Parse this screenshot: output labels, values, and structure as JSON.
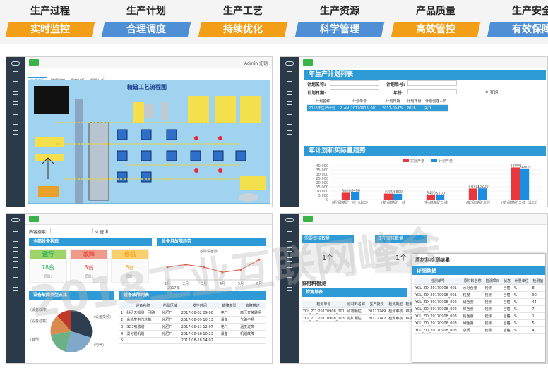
{
  "header": {
    "columns": [
      {
        "title": "生产过程",
        "badge": "实时监控",
        "color": "#f29e16"
      },
      {
        "title": "生产计划",
        "badge": "合理调度",
        "color": "#4f8fd6"
      },
      {
        "title": "生产工艺",
        "badge": "持续优化",
        "color": "#f29e16"
      },
      {
        "title": "生产资源",
        "badge": "科学管理",
        "color": "#4f8fd6"
      },
      {
        "title": "产品质量",
        "badge": "高效管控",
        "color": "#f29e16"
      },
      {
        "title": "生产安全",
        "badge": "有效保障",
        "color": "#4f8fd6"
      }
    ]
  },
  "panel_process": {
    "tabs": [
      "工艺流程",
      "数据监控",
      "报表分析",
      "报警分析"
    ],
    "diagram_title": "精硫工艺流程图",
    "user_label": "Admin 注销"
  },
  "panel_plan": {
    "title": "年生产计划列表",
    "plan_name_label": "计划名称:",
    "plan_no_label": "计划单号:",
    "plan_date_label": "计划日期:",
    "year_label": "年份:",
    "query_button": "查询",
    "table": {
      "headers": [
        "计划名称",
        "计划单号",
        "计划日期",
        "计划年份",
        "计划创建人员"
      ],
      "row": [
        "2016年生产计划",
        "PLAN_20170915_001",
        "2017-09-05",
        "2016",
        "关飞"
      ]
    },
    "chart_title": "年计划和实际量趋势"
  },
  "chart_data": {
    "type": "bar",
    "categories": [
      "(新)硫精矿一线（出口）",
      "(新)硫精矿一线",
      "(新)硫精矿二线",
      "(新)硫精矿三线",
      "(新)硫精矿二线（出口）"
    ],
    "series": [
      {
        "name": "实际产量",
        "values": [
          8000,
          7000,
          5400,
          13000,
          38000
        ],
        "color": "#e8383d"
      },
      {
        "name": "计划产量",
        "values": [
          8400,
          6800,
          5200,
          13200,
          36000
        ],
        "color": "#1c8de0"
      }
    ],
    "ylim": [
      0,
      40000
    ],
    "yticks": [
      0,
      5000,
      10000,
      15000,
      20000,
      25000,
      30000,
      35000,
      40000
    ],
    "ytick_labels": [
      "0",
      "5,000",
      "10,000",
      "15,000",
      "20,000",
      "25,000",
      "30,000",
      "35,000",
      "40,000"
    ],
    "data_labels": [
      "8000",
      "8400",
      "7000",
      "6800",
      "5400",
      "5200",
      "13000",
      "13200",
      "38000",
      "36000"
    ]
  },
  "panel_equipment": {
    "search_label": "内容搜索:",
    "query_button": "查询",
    "status_title": "全部设备状态",
    "status": [
      {
        "label": "运行",
        "count": "78台",
        "color": "#27ae60",
        "bar": "#9ed36a"
      },
      {
        "label": "故障",
        "count": "3台",
        "color": "#e74c3c",
        "bar": "#f09a8c"
      },
      {
        "label": "停机",
        "count": "8台",
        "color": "#f5a623",
        "bar": "#f7cf6c"
      }
    ],
    "ratio_label": "同比",
    "trend_title": "设备月故障趋势",
    "trend_legend": "故障设备数",
    "trend_months": [
      "2017年",
      "1月",
      "2月",
      "3月",
      "4月",
      "5月",
      "6月"
    ],
    "trend_points": [
      5,
      6,
      5,
      3,
      4,
      8
    ],
    "pie_title": "设备故障类型占比",
    "pie_legend": [
      "(设备故障)",
      "(设备过载)",
      "(设备变频)",
      "(其他)",
      "(电气)"
    ],
    "list_title": "设备故障列表",
    "list_headers": [
      "",
      "设备名称",
      "所属区域",
      "发生时间",
      "故障类型",
      "故障描述"
    ],
    "list_rows": [
      [
        "1",
        "科研无损测一回路",
        "化肥厂",
        "2017-08-02 09:00",
        "电气",
        "高压开关跳闸"
      ],
      [
        "2",
        "余热发电汽轮机",
        "化肥厂",
        "2017-08-09 10:13",
        "设备",
        "气路不畅"
      ],
      [
        "3",
        "SO3吸收塔",
        "化肥厂",
        "2017-08-11 12:07",
        "电气",
        "温度过高"
      ],
      [
        "4",
        "溴化锂机组",
        "化肥厂",
        "2017-08-16 10:23",
        "设备",
        "机组故障"
      ],
      [
        "5",
        "",
        "",
        "2017-08-18 14:02",
        "",
        ""
      ]
    ]
  },
  "panel_quality": {
    "card1_label": "需要审核数量",
    "card1_value": "1个",
    "card2_label": "正在审核数量",
    "card2_value": "1个",
    "material_title": "原材料检测",
    "detect_title": "检测总表",
    "detect_headers": [
      "检测单号",
      "原材料名称",
      "生产批次",
      "检测类型",
      "检测状态"
    ],
    "detect_rows": [
      [
        "YCL_ZD_20170908_001",
        "矿物颗粒",
        "20171249",
        "检测审核",
        "审核"
      ],
      [
        "YCL_ZD_20170908_003",
        "铁矿颗粒",
        "20172142",
        "检测审核",
        "审核"
      ]
    ],
    "result_title": "原材料检测结果",
    "detail_title": "详细数据",
    "detail_headers": [
      "检测单号",
      "原材料名称",
      "检测项目",
      "状态",
      "计量单位",
      "检测值"
    ],
    "detail_rows": [
      [
        "YCL_ZD_20170908_001",
        "水分含量",
        "检测",
        "合格",
        "%",
        "8"
      ],
      [
        "YCL_ZD_20170908_001",
        "粒度",
        "检测",
        "合格",
        "%",
        "90"
      ],
      [
        "YCL_ZD_20170908_002",
        "硫含量",
        "检测",
        "合格",
        "%",
        "44"
      ],
      [
        "YCL_ZD_20170908_002",
        "铁含量",
        "检测",
        "合格",
        "%",
        "7"
      ],
      [
        "YCL_ZD_20170908_003",
        "铅含量",
        "检测",
        "合格",
        "%",
        "1"
      ],
      [
        "YCL_ZD_20170908_003",
        "砷含量",
        "检测",
        "合格",
        "%",
        "5"
      ],
      [
        "YCL_ZD_20170908_003",
        "杂质",
        "检测",
        "合格",
        "%",
        "4"
      ]
    ]
  },
  "watermark": "2018工业互联网峰会"
}
